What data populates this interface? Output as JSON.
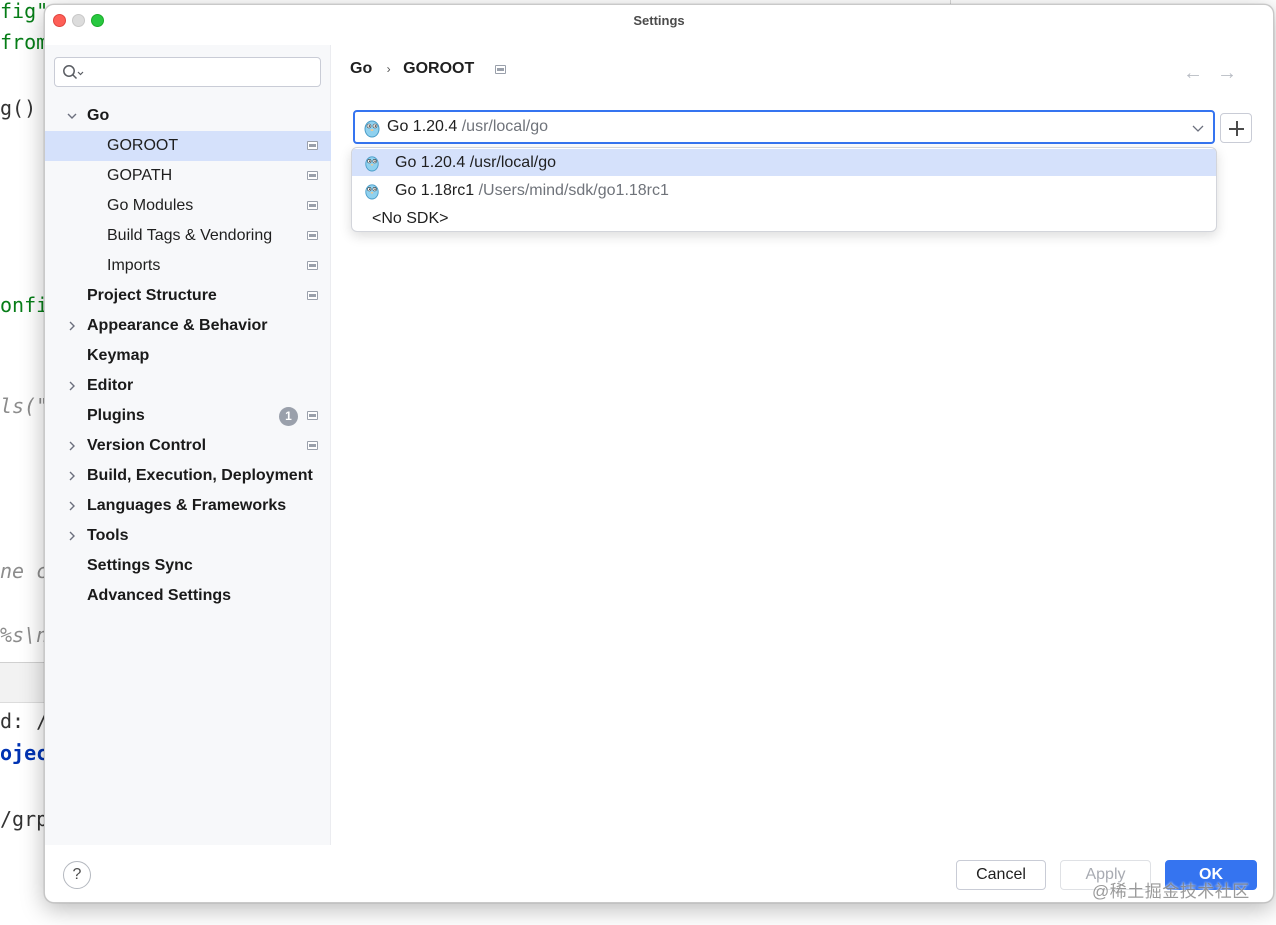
{
  "background_editor": {
    "lines": [
      "fig\"",
      "fromM",
      "g()",
      "onfig",
      "ls(\"",
      "ne cl",
      "%s\\n",
      "d: /",
      "ojec",
      "/grp"
    ]
  },
  "dialog": {
    "title": "Settings",
    "search_placeholder": ""
  },
  "sidebar": {
    "items": [
      {
        "label": "Go",
        "expanded": true
      },
      {
        "label": "GOROOT",
        "selected": true
      },
      {
        "label": "GOPATH"
      },
      {
        "label": "Go Modules"
      },
      {
        "label": "Build Tags & Vendoring"
      },
      {
        "label": "Imports"
      },
      {
        "label": "Project Structure"
      },
      {
        "label": "Appearance & Behavior",
        "expandable": true
      },
      {
        "label": "Keymap"
      },
      {
        "label": "Editor",
        "expandable": true
      },
      {
        "label": "Plugins",
        "badge": "1"
      },
      {
        "label": "Version Control",
        "expandable": true
      },
      {
        "label": "Build, Execution, Deployment",
        "expandable": true
      },
      {
        "label": "Languages & Frameworks",
        "expandable": true
      },
      {
        "label": "Tools",
        "expandable": true
      },
      {
        "label": "Settings Sync"
      },
      {
        "label": "Advanced Settings"
      }
    ]
  },
  "breadcrumb": {
    "parent": "Go",
    "separator": "›",
    "current": "GOROOT"
  },
  "sdk_combo": {
    "selected_name": "Go 1.20.4",
    "selected_path": "/usr/local/go"
  },
  "sdk_options": [
    {
      "name": "Go 1.20.4",
      "path": " /usr/local/go"
    },
    {
      "name": "Go 1.18rc1",
      "path": " /Users/mind/sdk/go1.18rc1"
    },
    {
      "name": "<No SDK>",
      "path": ""
    }
  ],
  "footer": {
    "help_label": "?",
    "cancel_label": "Cancel",
    "apply_label": "Apply",
    "ok_label": "OK"
  },
  "watermark": "@稀土掘金技术社区",
  "colors": {
    "accent": "#3574f0",
    "selection": "#d5e1fb",
    "close": "#fe5f57",
    "maximize": "#28c840"
  }
}
